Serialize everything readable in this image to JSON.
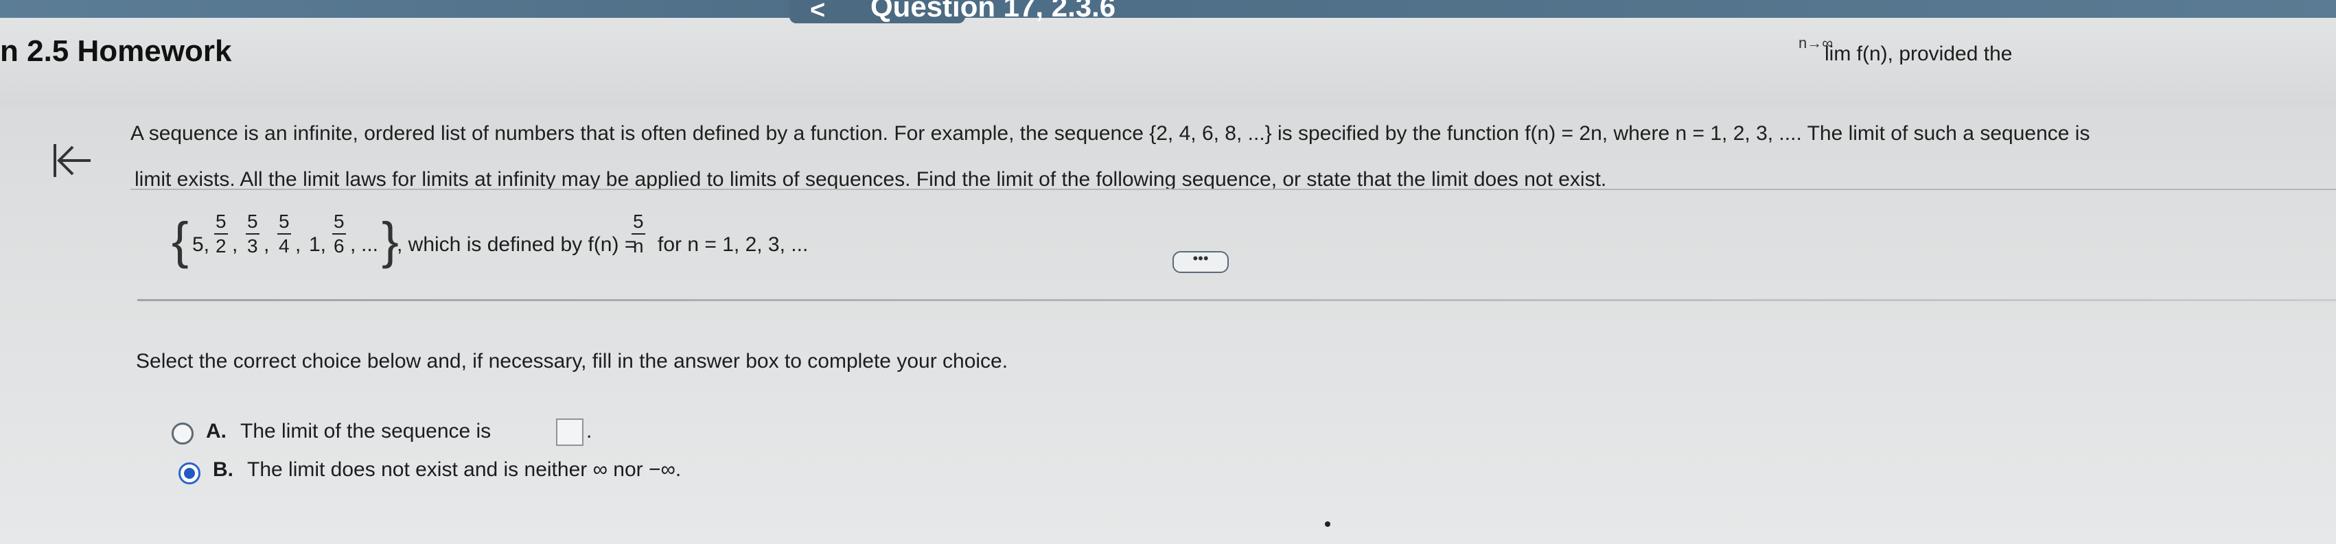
{
  "header": {
    "title": "n 2.5 Homework",
    "question_label": "Question 17, 2.3.6",
    "nav_prev_symbol": "<"
  },
  "problem": {
    "line1": "A sequence is an infinite, ordered list of numbers that is often defined by a function. For example, the sequence {2, 4, 6, 8, ...} is specified by the function f(n) = 2n, where n = 1, 2, 3, .... The limit of such a sequence is",
    "line1_right": "lim  f(n), provided the",
    "lim_sub": "n→∞",
    "line2": "limit exists. All the limit laws for limits at infinity may be applied to limits of sequences. Find the limit of the following sequence, or state that the limit does not exist."
  },
  "sequence": {
    "first": "5,",
    "fractions": [
      {
        "num": "5",
        "den": "2"
      },
      {
        "num": "5",
        "den": "3"
      },
      {
        "num": "5",
        "den": "4"
      }
    ],
    "one": "1,",
    "last_frac": {
      "num": "5",
      "den": "6"
    },
    "ellipsis": "...",
    "defined_by": ", which is defined by f(n) =",
    "fn_frac": {
      "num": "5",
      "den": "n"
    },
    "domain": "for n = 1, 2, 3, ..."
  },
  "more_button": "•••",
  "instruction": "Select the correct choice below and, if necessary, fill in the answer box to complete your choice.",
  "choices": [
    {
      "letter": "A.",
      "text": "The limit of the sequence is",
      "selected": false
    },
    {
      "letter": "B.",
      "text": "The limit does not exist and is neither ∞ nor −∞.",
      "selected": true
    }
  ]
}
